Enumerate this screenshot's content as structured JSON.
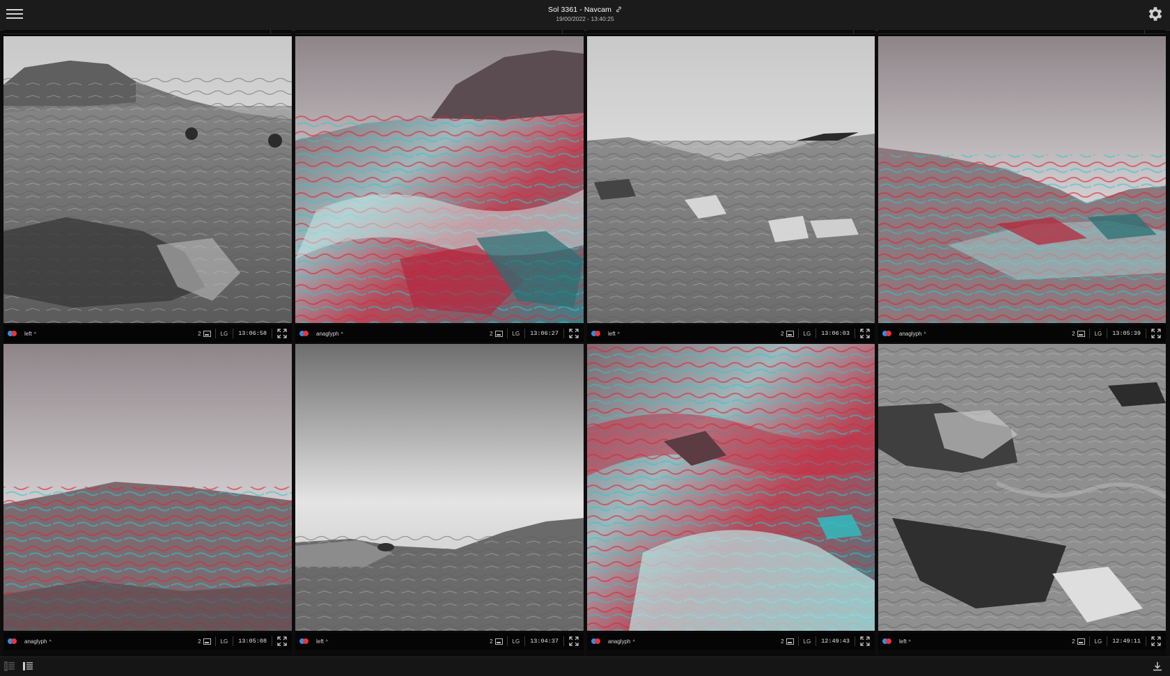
{
  "header": {
    "title": "Sol 3361 - Navcam",
    "subtitle": "19/00/2022 - 13:40:25",
    "menu_icon": "hamburger-menu-icon",
    "settings_icon": "gear-icon",
    "link_icon": "link-icon"
  },
  "colors": {
    "anaglyph_red": "#e8343b",
    "anaglyph_cyan": "#2e8ee6",
    "background": "#0d0d0d"
  },
  "tiles": [
    {
      "mode": "left",
      "count": "2",
      "camera": "LG",
      "time": "13:06:58",
      "kind": "mono"
    },
    {
      "mode": "anaglyph",
      "count": "2",
      "camera": "LG",
      "time": "13:06:27",
      "kind": "anaglyph"
    },
    {
      "mode": "left",
      "count": "2",
      "camera": "LG",
      "time": "13:06:03",
      "kind": "mono"
    },
    {
      "mode": "anaglyph",
      "count": "2",
      "camera": "LG",
      "time": "13:05:39",
      "kind": "anaglyph"
    },
    {
      "mode": "anaglyph",
      "count": "2",
      "camera": "LG",
      "time": "13:05:08",
      "kind": "anaglyph"
    },
    {
      "mode": "left",
      "count": "2",
      "camera": "LG",
      "time": "13:04:37",
      "kind": "mono"
    },
    {
      "mode": "anaglyph",
      "count": "2",
      "camera": "LG",
      "time": "12:49:43",
      "kind": "anaglyph"
    },
    {
      "mode": "left",
      "count": "2",
      "camera": "LG",
      "time": "12:49:11",
      "kind": "mono"
    }
  ],
  "footer": {
    "left_icons": [
      "collapse-list-icon",
      "expand-list-icon"
    ],
    "right_icon": "download-icon"
  }
}
